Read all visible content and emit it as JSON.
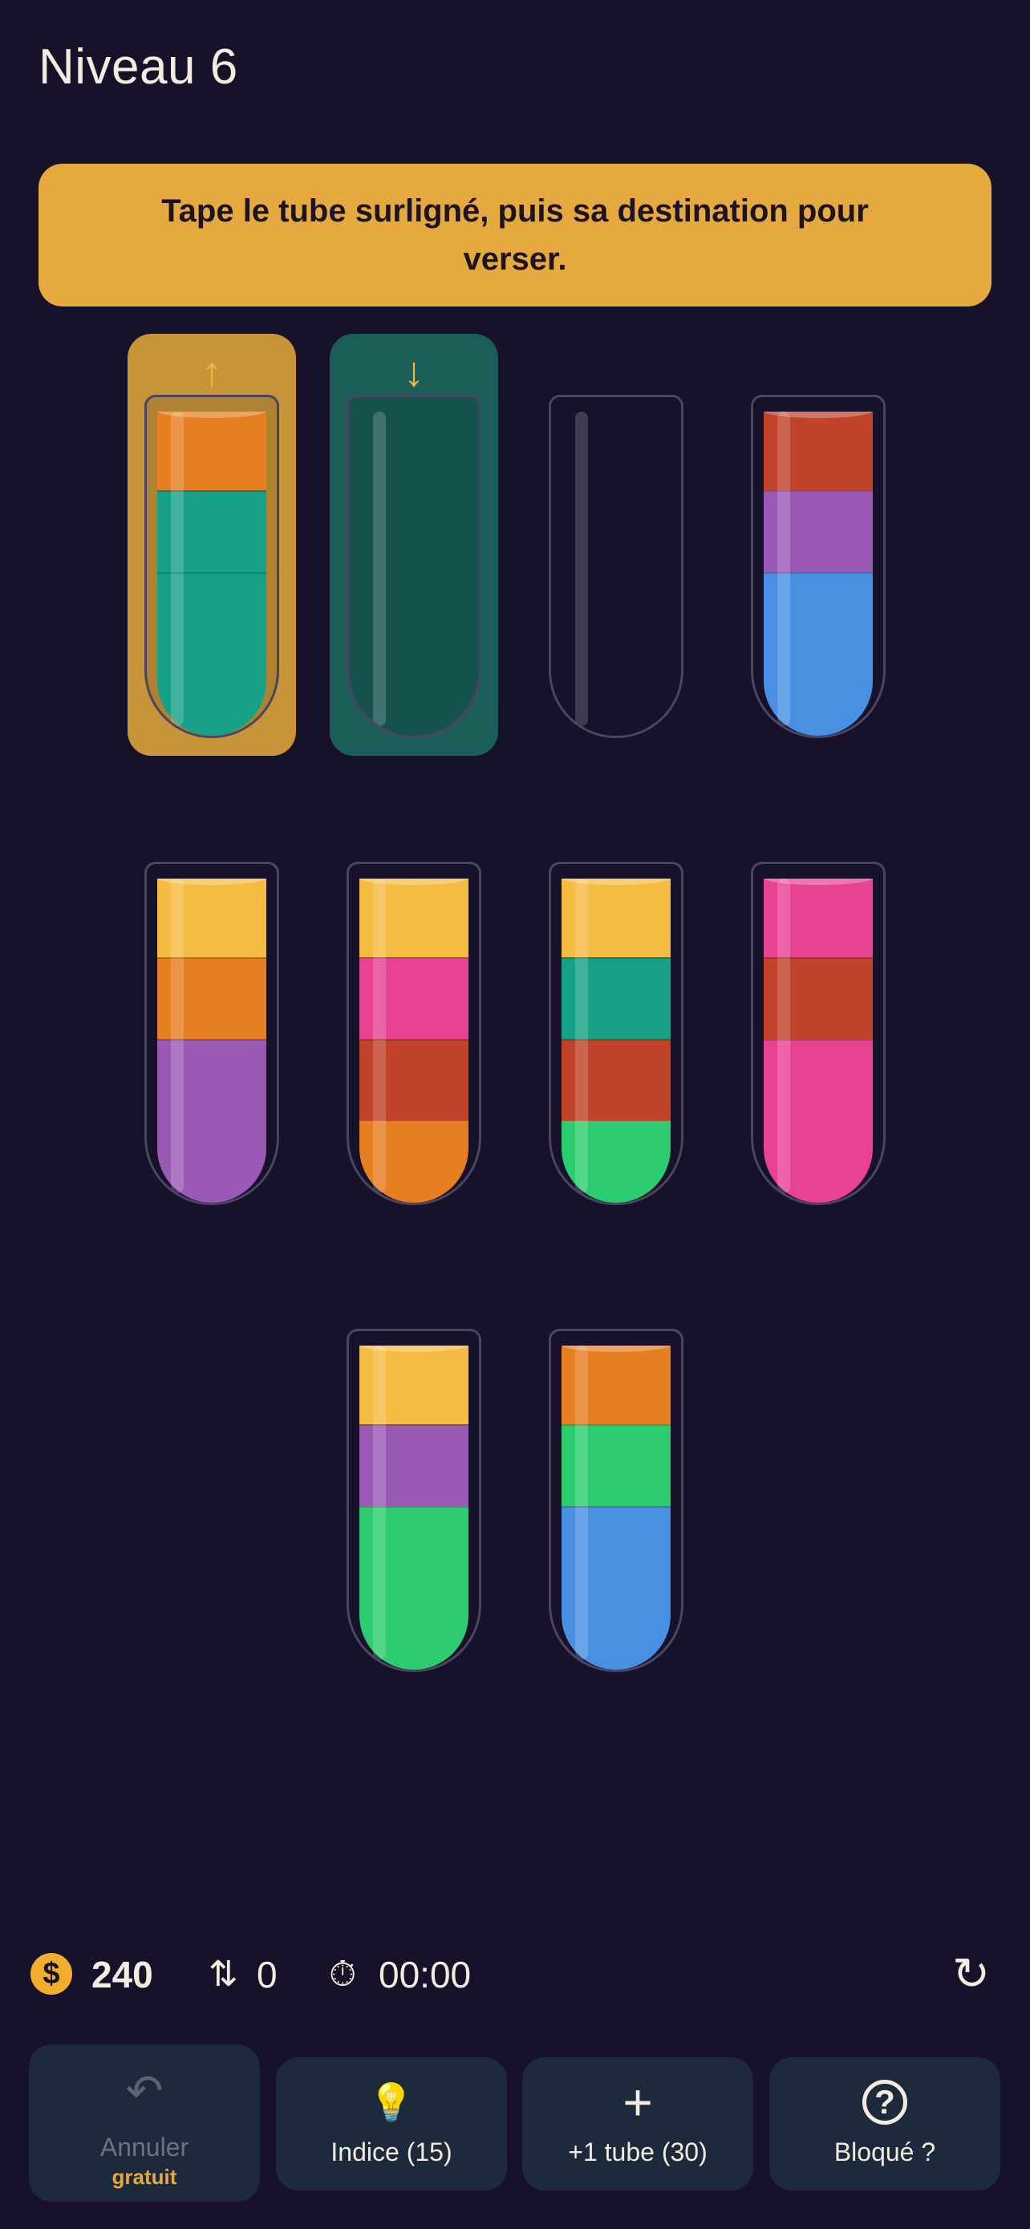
{
  "level_title": "Niveau 6",
  "instruction": "Tape le tube surligné, puis sa destination pour verser.",
  "colors": {
    "orange": "#e67e22",
    "teal": "#16a085",
    "red": "#c0432a",
    "purple": "#9b59b6",
    "blue": "#4a90e2",
    "yellow": "#f6bb42",
    "pink": "#e84393",
    "green": "#2ecc71",
    "source_highlight": "#c8943a",
    "target_highlight": "#1a5e58"
  },
  "tubes": [
    {
      "segments": [
        "teal",
        "teal",
        "teal",
        "orange"
      ],
      "highlight": "source"
    },
    {
      "segments": [],
      "highlight": "target"
    },
    {
      "segments": [],
      "highlight": ""
    },
    {
      "segments": [
        "blue",
        "blue",
        "purple",
        "red"
      ],
      "highlight": ""
    },
    {
      "segments": [
        "purple",
        "purple",
        "orange",
        "yellow"
      ],
      "highlight": ""
    },
    {
      "segments": [
        "orange",
        "red",
        "pink",
        "yellow"
      ],
      "highlight": ""
    },
    {
      "segments": [
        "green",
        "red",
        "teal",
        "yellow"
      ],
      "highlight": ""
    },
    {
      "segments": [
        "pink",
        "pink",
        "red",
        "pink"
      ],
      "highlight": ""
    },
    {
      "segments": [
        "green",
        "green",
        "purple",
        "yellow"
      ],
      "highlight": ""
    },
    {
      "segments": [
        "blue",
        "blue",
        "green",
        "orange"
      ],
      "highlight": ""
    }
  ],
  "source_arrow": "↑",
  "target_arrow": "↓",
  "stats": {
    "coin_icon": "dollar-coin-icon",
    "coin_glyph": "$",
    "coins": "240",
    "moves_icon": "swap-arrows-icon",
    "moves_glyph": "⇅",
    "moves": "0",
    "timer_icon": "stopwatch-icon",
    "timer_glyph": "⏱",
    "time": "00:00",
    "restart_icon": "restart-icon",
    "restart_glyph": "↻"
  },
  "buttons": {
    "undo": {
      "icon": "undo-icon",
      "glyph": "↶",
      "label": "Annuler",
      "sub": "gratuit"
    },
    "hint": {
      "icon": "lightbulb-icon",
      "glyph": "💡",
      "label": "Indice (15)"
    },
    "add_tube": {
      "icon": "plus-icon",
      "glyph": "+",
      "label": "+1 tube (30)"
    },
    "stuck": {
      "icon": "question-icon",
      "glyph": "?",
      "label": "Bloqué ?"
    }
  }
}
